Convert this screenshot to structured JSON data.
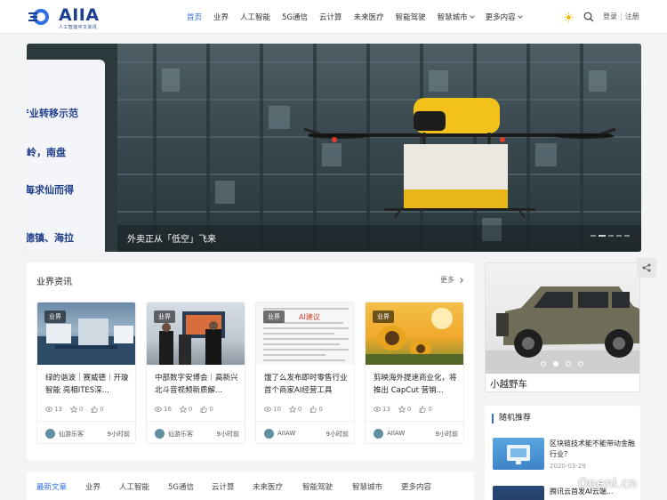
{
  "header": {
    "logo_text": "AIIA",
    "logo_subtitle": "人工智能中文资讯",
    "nav": [
      {
        "label": "首页",
        "active": true,
        "dropdown": false
      },
      {
        "label": "业界",
        "active": false,
        "dropdown": false
      },
      {
        "label": "人工智能",
        "active": false,
        "dropdown": false
      },
      {
        "label": "5G通信",
        "active": false,
        "dropdown": false
      },
      {
        "label": "云计算",
        "active": false,
        "dropdown": false
      },
      {
        "label": "未来医疗",
        "active": false,
        "dropdown": false
      },
      {
        "label": "智能驾驶",
        "active": false,
        "dropdown": false
      },
      {
        "label": "智慧城市",
        "active": false,
        "dropdown": true
      },
      {
        "label": "更多内容",
        "active": false,
        "dropdown": true
      }
    ],
    "login": "登录",
    "register": "注册",
    "accent": "#2f6fe4"
  },
  "slider": {
    "side_lines": [
      "产业转移示范",
      "岭，南盘",
      "每求仙而得",
      "德镇、海拉"
    ],
    "caption": "外卖正从「低空」飞来",
    "slide_count": 5,
    "active_slide": 2
  },
  "industry": {
    "title": "业界资讯",
    "more": "更多",
    "cards": [
      {
        "tag": "业界",
        "title": "绿的谐波｜赛威德｜开璇智能 亮相ITES深...",
        "views": "13",
        "stars": "0",
        "likes": "0",
        "author": "仙游乐客",
        "time": "9小时前"
      },
      {
        "tag": "业界",
        "title": "中部数字安博会｜高新兴北斗音视频新质解...",
        "views": "16",
        "stars": "0",
        "likes": "0",
        "author": "仙游乐客",
        "time": "9小时前"
      },
      {
        "tag": "业界",
        "title": "饿了么发布即时零售行业首个商家AI经营工具",
        "views": "10",
        "stars": "0",
        "likes": "0",
        "author": "AIIAW",
        "time": "9小时前",
        "img_text": "AI建议"
      },
      {
        "tag": "业界",
        "title": "剪映海外提速商业化，将推出 CapCut 营销...",
        "views": "13",
        "stars": "0",
        "likes": "0",
        "author": "AIIAW",
        "time": "9小时前"
      }
    ]
  },
  "tabs": [
    "最新文章",
    "业界",
    "人工智能",
    "5G通信",
    "云计算",
    "未来医疗",
    "智能驾驶",
    "智慧城市",
    "更多内容"
  ],
  "sidebar": {
    "car_caption": "小越野车",
    "car_slide_count": 4,
    "car_active_slide": 2,
    "random_title": "随机推荐",
    "random_items": [
      {
        "title": "区块链技术能不能带动金融行业？",
        "date": "2020-03-29"
      },
      {
        "title": "腾讯云首发AI云端...",
        "date": ""
      }
    ]
  },
  "watermark": "Openl.cn"
}
